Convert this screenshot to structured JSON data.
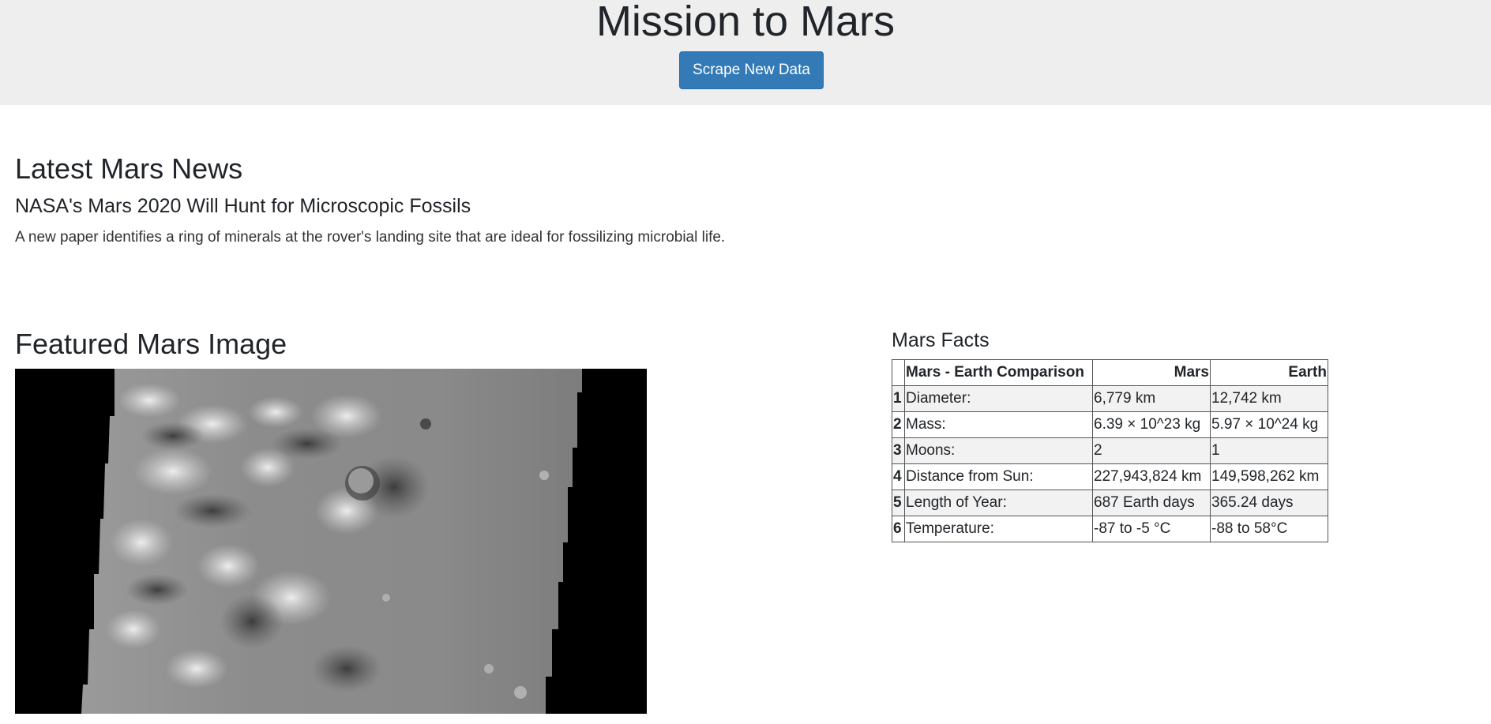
{
  "header": {
    "title": "Mission to Mars",
    "scrape_button_label": "Scrape New Data"
  },
  "news": {
    "section_heading": "Latest Mars News",
    "title": "NASA's Mars 2020 Will Hunt for Microscopic Fossils",
    "teaser": "A new paper identifies a ring of minerals at the rover's landing site that are ideal for fossilizing microbial life."
  },
  "featured_image": {
    "section_heading": "Featured Mars Image"
  },
  "facts": {
    "section_heading": "Mars Facts",
    "columns": [
      "",
      "Mars - Earth Comparison",
      "Mars",
      "Earth"
    ],
    "rows": [
      {
        "index": "1",
        "label": "Diameter:",
        "mars": "6,779 km",
        "earth": "12,742 km"
      },
      {
        "index": "2",
        "label": "Mass:",
        "mars": "6.39 × 10^23 kg",
        "earth": "5.97 × 10^24 kg"
      },
      {
        "index": "3",
        "label": "Moons:",
        "mars": "2",
        "earth": "1"
      },
      {
        "index": "4",
        "label": "Distance from Sun:",
        "mars": "227,943,824 km",
        "earth": "149,598,262 km"
      },
      {
        "index": "5",
        "label": "Length of Year:",
        "mars": "687 Earth days",
        "earth": "365.24 days"
      },
      {
        "index": "6",
        "label": "Temperature:",
        "mars": "-87 to -5 °C",
        "earth": "-88 to 58°C"
      }
    ]
  },
  "colors": {
    "jumbotron_bg": "#eeeeee",
    "button_primary": "#337ab7",
    "table_stripe": "#f2f2f2"
  }
}
